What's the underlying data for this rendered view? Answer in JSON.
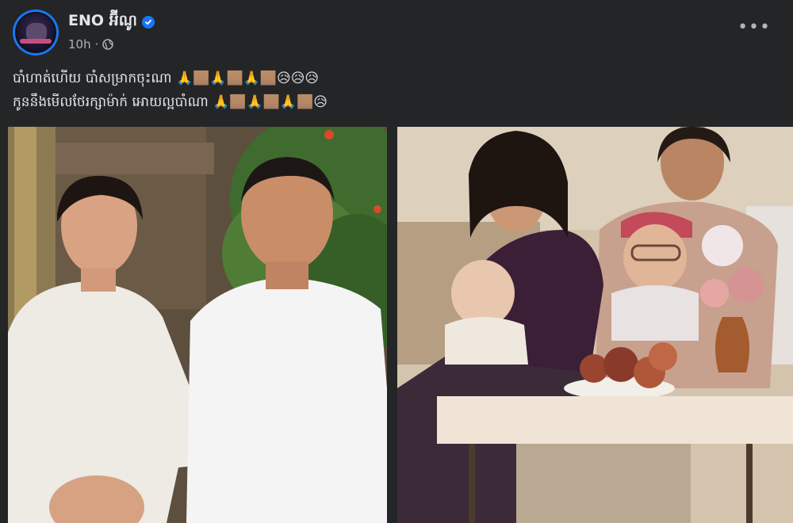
{
  "post": {
    "author": "ENO អ៊ីណូ",
    "timestamp": "10h",
    "separator": "·",
    "audience_icon": "globe-icon",
    "verified_icon": "verified-badge-icon",
    "more_icon": "more-options-icon",
    "more_label": "•••",
    "caption_line1_text": "បាំហាត់ហើយ បាំសម្រាកចុះណា",
    "caption_line1_emoji": "🙏🏽🙏🏽🙏🏽😥😥😥",
    "caption_line2_text": "កូននឹងមើលថែរក្សាម៉ាក់ អោយល្អបាំណា",
    "caption_line2_emoji": "🙏🏽🙏🏽🙏🏽😥"
  },
  "colors": {
    "background": "#242526",
    "text_primary": "#e4e6eb",
    "text_secondary": "#b0b3b8",
    "accent": "#1877f2"
  }
}
